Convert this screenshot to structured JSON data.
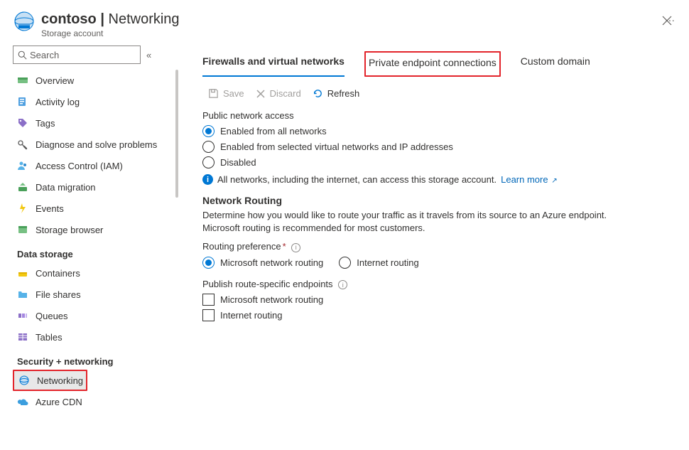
{
  "header": {
    "resource_name": "contoso",
    "separator": " | ",
    "page_title": "Networking",
    "resource_type": "Storage account",
    "more": "···"
  },
  "search": {
    "placeholder": "Search",
    "collapse_glyph": "«"
  },
  "sidebar": {
    "items1": [
      {
        "label": "Overview"
      },
      {
        "label": "Activity log"
      },
      {
        "label": "Tags"
      },
      {
        "label": "Diagnose and solve problems"
      },
      {
        "label": "Access Control (IAM)"
      },
      {
        "label": "Data migration"
      },
      {
        "label": "Events"
      },
      {
        "label": "Storage browser"
      }
    ],
    "group_data_storage": "Data storage",
    "items2": [
      {
        "label": "Containers"
      },
      {
        "label": "File shares"
      },
      {
        "label": "Queues"
      },
      {
        "label": "Tables"
      }
    ],
    "group_security": "Security + networking",
    "items3": [
      {
        "label": "Networking"
      },
      {
        "label": "Azure CDN"
      }
    ]
  },
  "tabs": {
    "t0": "Firewalls and virtual networks",
    "t1": "Private endpoint connections",
    "t2": "Custom domain"
  },
  "toolbar": {
    "save": "Save",
    "discard": "Discard",
    "refresh": "Refresh"
  },
  "public_access": {
    "label": "Public network access",
    "opt0": "Enabled from all networks",
    "opt1": "Enabled from selected virtual networks and IP addresses",
    "opt2": "Disabled",
    "info_text": "All networks, including the internet, can access this storage account.",
    "learn_more": "Learn more"
  },
  "routing": {
    "title": "Network Routing",
    "desc": "Determine how you would like to route your traffic as it travels from its source to an Azure endpoint. Microsoft routing is recommended for most customers.",
    "pref_label": "Routing preference",
    "opt_ms": "Microsoft network routing",
    "opt_inet": "Internet routing",
    "publish_label": "Publish route-specific endpoints",
    "chk_ms": "Microsoft network routing",
    "chk_inet": "Internet routing"
  }
}
